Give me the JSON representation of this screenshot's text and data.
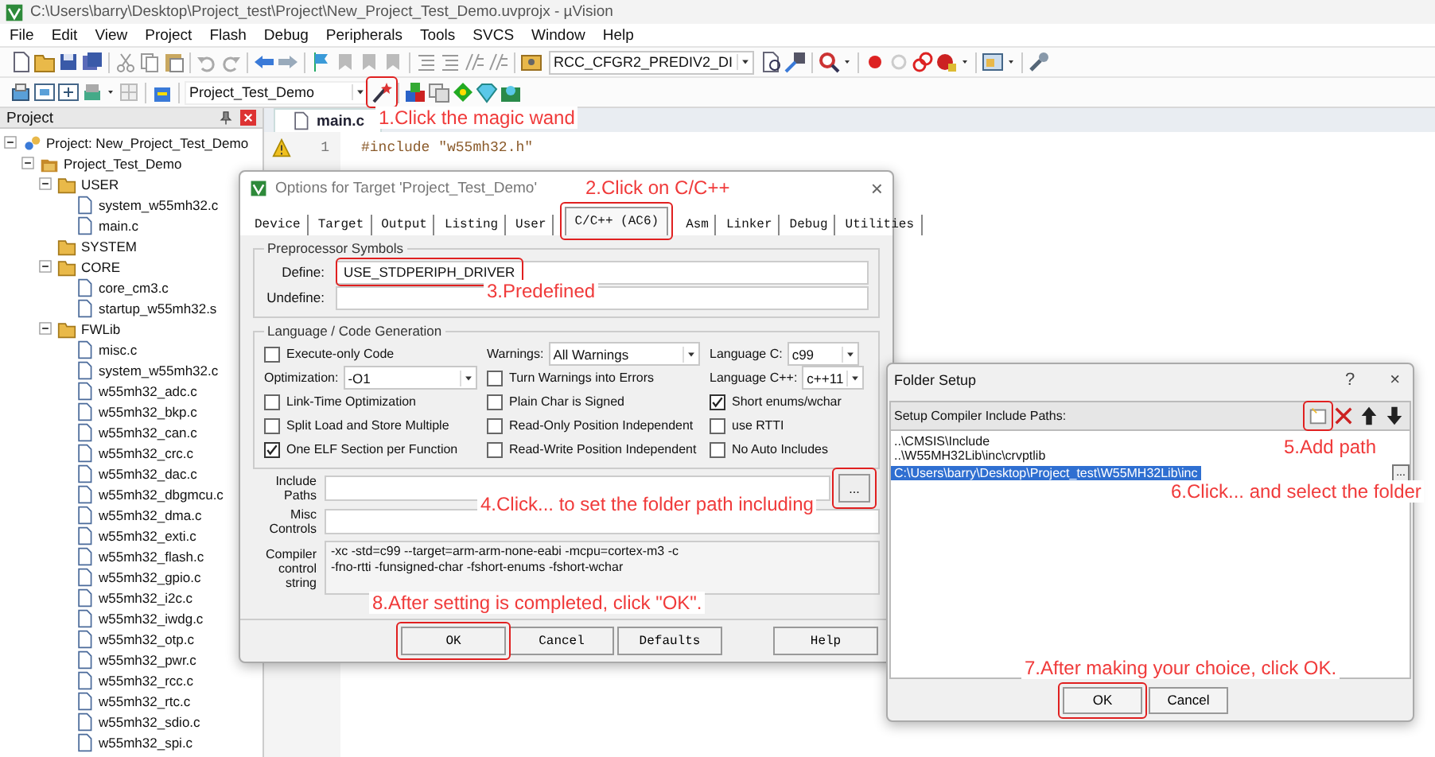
{
  "window": {
    "title": "C:\\Users\\barry\\Desktop\\Project_test\\Project\\New_Project_Test_Demo.uvprojx - µVision"
  },
  "menu": [
    "File",
    "Edit",
    "View",
    "Project",
    "Flash",
    "Debug",
    "Peripherals",
    "Tools",
    "SVCS",
    "Window",
    "Help"
  ],
  "toolbar": {
    "config_dropdown": "RCC_CFGR2_PREDIV2_DI",
    "target_dropdown": "Project_Test_Demo"
  },
  "project_panel": {
    "title": "Project",
    "tree": [
      {
        "label": "Project: New_Project_Test_Demo",
        "kind": "project",
        "expanded": true,
        "children": [
          {
            "label": "Project_Test_Demo",
            "kind": "target",
            "expanded": true,
            "children": [
              {
                "label": "USER",
                "kind": "group",
                "expanded": true,
                "children": [
                  {
                    "label": "system_w55mh32.c",
                    "kind": "file"
                  },
                  {
                    "label": "main.c",
                    "kind": "file"
                  }
                ]
              },
              {
                "label": "SYSTEM",
                "kind": "group"
              },
              {
                "label": "CORE",
                "kind": "group",
                "expanded": true,
                "children": [
                  {
                    "label": "core_cm3.c",
                    "kind": "file"
                  },
                  {
                    "label": "startup_w55mh32.s",
                    "kind": "file"
                  }
                ]
              },
              {
                "label": "FWLib",
                "kind": "group",
                "expanded": true,
                "children": [
                  {
                    "label": "misc.c",
                    "kind": "file"
                  },
                  {
                    "label": "system_w55mh32.c",
                    "kind": "file"
                  },
                  {
                    "label": "w55mh32_adc.c",
                    "kind": "file"
                  },
                  {
                    "label": "w55mh32_bkp.c",
                    "kind": "file"
                  },
                  {
                    "label": "w55mh32_can.c",
                    "kind": "file"
                  },
                  {
                    "label": "w55mh32_crc.c",
                    "kind": "file"
                  },
                  {
                    "label": "w55mh32_dac.c",
                    "kind": "file"
                  },
                  {
                    "label": "w55mh32_dbgmcu.c",
                    "kind": "file"
                  },
                  {
                    "label": "w55mh32_dma.c",
                    "kind": "file"
                  },
                  {
                    "label": "w55mh32_exti.c",
                    "kind": "file"
                  },
                  {
                    "label": "w55mh32_flash.c",
                    "kind": "file"
                  },
                  {
                    "label": "w55mh32_gpio.c",
                    "kind": "file"
                  },
                  {
                    "label": "w55mh32_i2c.c",
                    "kind": "file"
                  },
                  {
                    "label": "w55mh32_iwdg.c",
                    "kind": "file"
                  },
                  {
                    "label": "w55mh32_otp.c",
                    "kind": "file"
                  },
                  {
                    "label": "w55mh32_pwr.c",
                    "kind": "file"
                  },
                  {
                    "label": "w55mh32_rcc.c",
                    "kind": "file"
                  },
                  {
                    "label": "w55mh32_rtc.c",
                    "kind": "file"
                  },
                  {
                    "label": "w55mh32_sdio.c",
                    "kind": "file"
                  },
                  {
                    "label": "w55mh32_spi.c",
                    "kind": "file"
                  }
                ]
              }
            ]
          }
        ]
      }
    ]
  },
  "editor": {
    "tabs": [
      {
        "label": "main.c",
        "selected": true
      }
    ],
    "lines": [
      {
        "number": "1",
        "code": "#include \"w55mh32.h\""
      }
    ]
  },
  "options_dialog": {
    "title": "Options for Target 'Project_Test_Demo'",
    "close": "×",
    "tabs": [
      {
        "label": "Device",
        "selected": false
      },
      {
        "label": "Target",
        "selected": false
      },
      {
        "label": "Output",
        "selected": false
      },
      {
        "label": "Listing",
        "selected": false
      },
      {
        "label": "User",
        "selected": false
      },
      {
        "label": "C/C++ (AC6)",
        "selected": true
      },
      {
        "label": "Asm",
        "selected": false
      },
      {
        "label": "Linker",
        "selected": false
      },
      {
        "label": "Debug",
        "selected": false
      },
      {
        "label": "Utilities",
        "selected": false
      }
    ],
    "preprocessor": {
      "title": "Preprocessor Symbols",
      "define_label": "Define:",
      "define": "USE_STDPERIPH_DRIVER",
      "undefine_label": "Undefine:"
    },
    "language": {
      "title": "Language / Code Generation",
      "options": [
        {
          "kind": "checkbox",
          "label": "Execute-only Code",
          "checked": false
        },
        {
          "kind": "select",
          "label": "Warnings:",
          "value": "All Warnings"
        },
        {
          "kind": "select",
          "label": "Language C:",
          "value": "c99"
        },
        {
          "kind": "select",
          "label": "Optimization:",
          "value": "-O1"
        },
        {
          "kind": "checkbox",
          "label": "Turn Warnings into Errors",
          "checked": false
        },
        {
          "kind": "select",
          "label": "Language C++:",
          "value": "c++11"
        },
        {
          "kind": "checkbox",
          "label": "Link-Time Optimization",
          "checked": false
        },
        {
          "kind": "checkbox",
          "label": "Plain Char is Signed",
          "checked": false
        },
        {
          "kind": "checkbox",
          "label": "Short enums/wchar",
          "checked": true
        },
        {
          "kind": "checkbox",
          "label": "Split Load and Store Multiple",
          "checked": false
        },
        {
          "kind": "checkbox",
          "label": "Read-Only Position Independent",
          "checked": false
        },
        {
          "kind": "checkbox",
          "label": "use RTTI",
          "checked": false
        },
        {
          "kind": "checkbox",
          "label": "One ELF Section per Function",
          "checked": true
        },
        {
          "kind": "checkbox",
          "label": "Read-Write Position Independent",
          "checked": false
        },
        {
          "kind": "checkbox",
          "label": "No Auto Includes",
          "checked": false
        }
      ]
    },
    "include_paths_label": "Include Paths",
    "browse": "...",
    "misc_label": "Misc Controls",
    "compiler_string": {
      "label": "Compiler control string",
      "lines": [
        "-xc -std=c99 --target=arm-arm-none-eabi -mcpu=cortex-m3 -c",
        "-fno-rtti -funsigned-char -fshort-enums -fshort-wchar"
      ]
    },
    "buttons": [
      "OK",
      "Cancel",
      "Defaults",
      "Help"
    ]
  },
  "folder_dialog": {
    "title": "Folder Setup",
    "help": "?",
    "close": "×",
    "header": "Setup Compiler Include Paths:",
    "paths": [
      {
        "text": "..\\CMSIS\\Include",
        "selected": false
      },
      {
        "text": "..\\W55MH32Lib\\inc\\crvptlib",
        "selected": false
      },
      {
        "text": "C:\\Users\\barry\\Desktop\\Project_test\\W55MH32Lib\\inc",
        "selected": true
      }
    ],
    "browse": "...",
    "buttons": [
      "OK",
      "Cancel"
    ]
  },
  "annotations": [
    {
      "text": "1.Click the magic wand"
    },
    {
      "text": "2.Click on C/C++"
    },
    {
      "text": "3.Predefined"
    },
    {
      "text": "4.Click... to set the folder path including"
    },
    {
      "text": "8.After setting is completed, click \"OK\"."
    },
    {
      "text": "5.Add path"
    },
    {
      "text": "6.Click... and select the folder"
    },
    {
      "text": "7.After making your choice, click OK."
    }
  ]
}
